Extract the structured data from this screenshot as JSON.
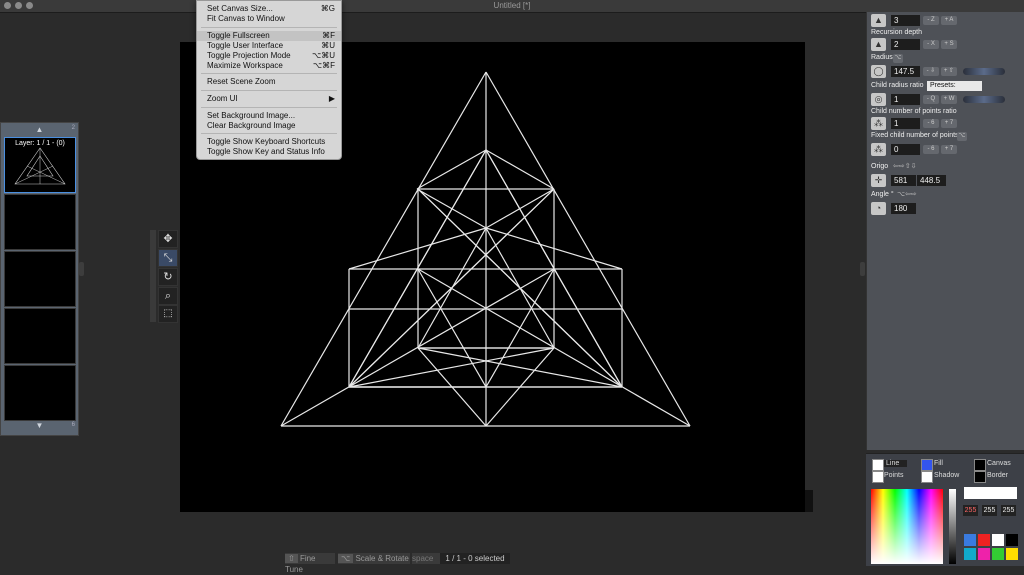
{
  "window": {
    "title": "Untitled [*]"
  },
  "menu": {
    "items": [
      {
        "label": "Set Canvas Size...",
        "shortcut": "⌘G"
      },
      {
        "label": "Fit Canvas to Window",
        "shortcut": ""
      },
      {
        "label": "Toggle Fullscreen",
        "shortcut": "⌘F"
      },
      {
        "label": "Toggle User Interface",
        "shortcut": "⌘U"
      },
      {
        "label": "Toggle Projection Mode",
        "shortcut": "⌥⌘U"
      },
      {
        "label": "Maximize Workspace",
        "shortcut": "⌥⌘F"
      },
      {
        "label": "Reset Scene Zoom",
        "shortcut": ""
      },
      {
        "label": "Zoom UI",
        "shortcut": "▶"
      },
      {
        "label": "Set Background Image...",
        "shortcut": ""
      },
      {
        "label": "Clear Background Image",
        "shortcut": ""
      },
      {
        "label": "Toggle Show Keyboard Shortcuts",
        "shortcut": ""
      },
      {
        "label": "Toggle Show Key and Status Info",
        "shortcut": ""
      }
    ]
  },
  "layers": {
    "label": "Layer: 1 / 1 - (0)",
    "up": "▲",
    "down": "▼",
    "top_num": "2",
    "bottom_num": "6"
  },
  "panel": {
    "points": {
      "value": "3",
      "minus": "- Z",
      "plus": "+ A"
    },
    "recursion": {
      "label": "Recursion depth",
      "value": "2",
      "minus": "- X",
      "plus": "+ S"
    },
    "radius": {
      "label": "Radius",
      "value": "147.5",
      "minus": "- ⇩",
      "plus": "+ ⇧",
      "key": "⌥"
    },
    "child_ratio": {
      "label": "Child radius ratio",
      "presets": "Presets:"
    },
    "child_ratio_row": {
      "value": "1",
      "minus": "- Q",
      "plus": "+ W"
    },
    "child_points": {
      "label": "Child number of points ratio",
      "value": "1",
      "minus": "- 6",
      "plus": "+ 7"
    },
    "fixed_points": {
      "label": "Fixed child number of points",
      "value": "0",
      "minus": "- 6",
      "plus": "+ 7",
      "key": "⌥"
    },
    "origo": {
      "label": "Origo",
      "x": "581",
      "y": "448.5",
      "arrows": "⇦⇨⇧⇩"
    },
    "angle": {
      "label": "Angle °",
      "value": "180",
      "key": "⌥⇦⇨"
    }
  },
  "colors": {
    "line": "Line",
    "fill": "Fill",
    "canvas": "Canvas",
    "points": "Points",
    "shadow": "Shadow",
    "border": "Border",
    "r": "255",
    "g": "255",
    "b": "255",
    "accent_fill": "#3355ee"
  },
  "bottom": {
    "fine_tune": "Fine Tune",
    "scale_rotate": "Scale & Rotate",
    "space": "space",
    "status": "1 / 1 - 0 selected",
    "opt": "⌥",
    "shift": "⇧"
  }
}
